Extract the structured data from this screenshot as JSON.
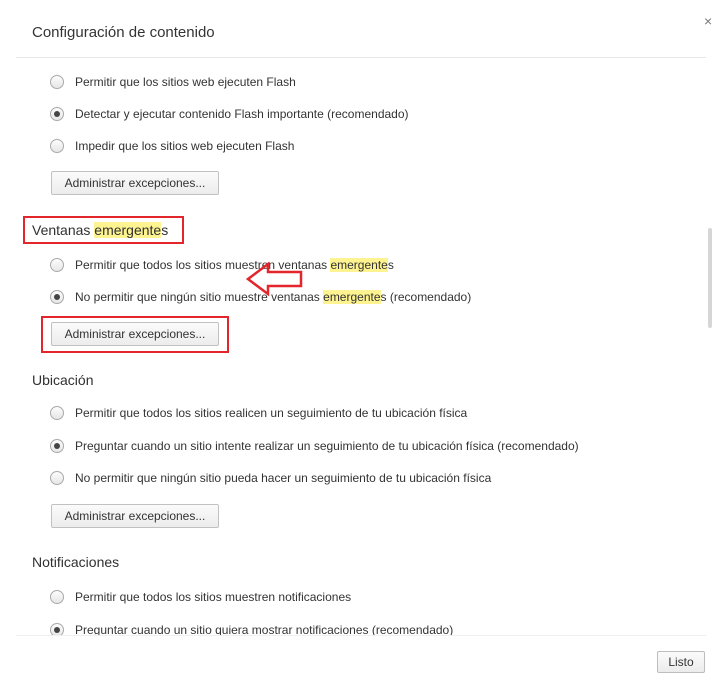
{
  "dialog": {
    "title": "Configuración de contenido",
    "close_glyph": "×",
    "done_label": "Listo"
  },
  "flash": {
    "options": [
      {
        "label": "Permitir que los sitios web ejecuten Flash",
        "checked": false
      },
      {
        "label": "Detectar y ejecutar contenido Flash importante (recomendado)",
        "checked": true
      },
      {
        "label": "Impedir que los sitios web ejecuten Flash",
        "checked": false
      }
    ],
    "button_label": "Administrar excepciones..."
  },
  "popups": {
    "heading_pre": "Ventanas ",
    "heading_hl": "emergente",
    "heading_post": "s",
    "options": [
      {
        "pre": "Permitir que todos los sitios muestren ventanas ",
        "hl": "emergente",
        "post": "s",
        "checked": false
      },
      {
        "pre": "No permitir que ningún sitio muestre ventanas ",
        "hl": "emergente",
        "post": "s (recomendado)",
        "checked": true
      }
    ],
    "button_label": "Administrar excepciones..."
  },
  "location": {
    "heading": "Ubicación",
    "options": [
      {
        "label": "Permitir que todos los sitios realicen un seguimiento de tu ubicación física",
        "checked": false
      },
      {
        "label": "Preguntar cuando un sitio intente realizar un seguimiento de tu ubicación física (recomendado)",
        "checked": true
      },
      {
        "label": "No permitir que ningún sitio pueda hacer un seguimiento de tu ubicación física",
        "checked": false
      }
    ],
    "button_label": "Administrar excepciones..."
  },
  "notifications": {
    "heading": "Notificaciones",
    "options": [
      {
        "label": "Permitir que todos los sitios muestren notificaciones",
        "checked": false
      },
      {
        "label": "Preguntar cuando un sitio quiera mostrar notificaciones (recomendado)",
        "checked": true
      }
    ]
  },
  "annotation": {
    "color": "#e3262b",
    "highlight_color": "#fdf391"
  }
}
